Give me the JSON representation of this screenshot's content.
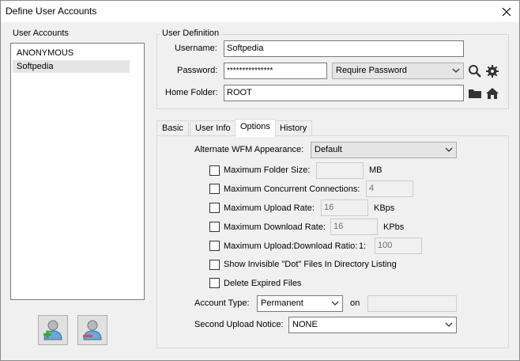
{
  "window": {
    "title": "Define User Accounts",
    "close_glyph": "✕"
  },
  "user_accounts": {
    "label": "User Accounts",
    "items": [
      "ANONYMOUS",
      "Softpedia"
    ],
    "selected": "Softpedia"
  },
  "user_definition": {
    "title": "User Definition",
    "username_label": "Username:",
    "username_value": "Softpedia",
    "password_label": "Password:",
    "password_value": "***************",
    "password_mode": "Require Password",
    "home_folder_label": "Home Folder:",
    "home_folder_value": "ROOT"
  },
  "tabs": [
    {
      "label": "Basic"
    },
    {
      "label": "User Info"
    },
    {
      "label": "Options"
    },
    {
      "label": "History"
    }
  ],
  "active_tab": "Options",
  "options": {
    "wfm_label": "Alternate WFM Appearance:",
    "wfm_value": "Default",
    "max_folder_size_label": "Maximum Folder Size:",
    "max_folder_size_value": "",
    "max_folder_size_unit": "MB",
    "max_concurrent_label": "Maximum Concurrent Connections:",
    "max_concurrent_value": "4",
    "max_upload_label": "Maximum Upload Rate:",
    "max_upload_value": "16",
    "max_upload_unit": "KBps",
    "max_download_label": "Maximum Download Rate:",
    "max_download_value": "16",
    "max_download_unit": "KPbs",
    "max_ratio_label": "Maximum Upload:Download Ratio:",
    "max_ratio_prefix": "1:",
    "max_ratio_value": "100",
    "show_dot_files_label": "Show Invisible \"Dot\" Files In Directory Listing",
    "delete_expired_label": "Delete Expired Files",
    "account_type_label": "Account Type:",
    "account_type_value": "Permanent",
    "on_label": "on",
    "on_value": "",
    "second_notice_label": "Second Upload Notice:",
    "second_notice_value": "NONE"
  },
  "checkboxes": {
    "max_folder_size": false,
    "max_concurrent": false,
    "max_upload": false,
    "max_download": false,
    "max_ratio": false,
    "show_dot_files": false,
    "delete_expired": false
  },
  "icons": {
    "search": "search-icon",
    "settings": "gear-icon",
    "folder": "folder-icon",
    "home": "home-icon",
    "add_user": "add-user-icon",
    "remove_user": "remove-user-icon"
  },
  "colors": {
    "window_bg": "#f0f0f0",
    "accent_blue": "#2f6db5",
    "add_green": "#3aa63a",
    "remove_red": "#d24b4b"
  }
}
